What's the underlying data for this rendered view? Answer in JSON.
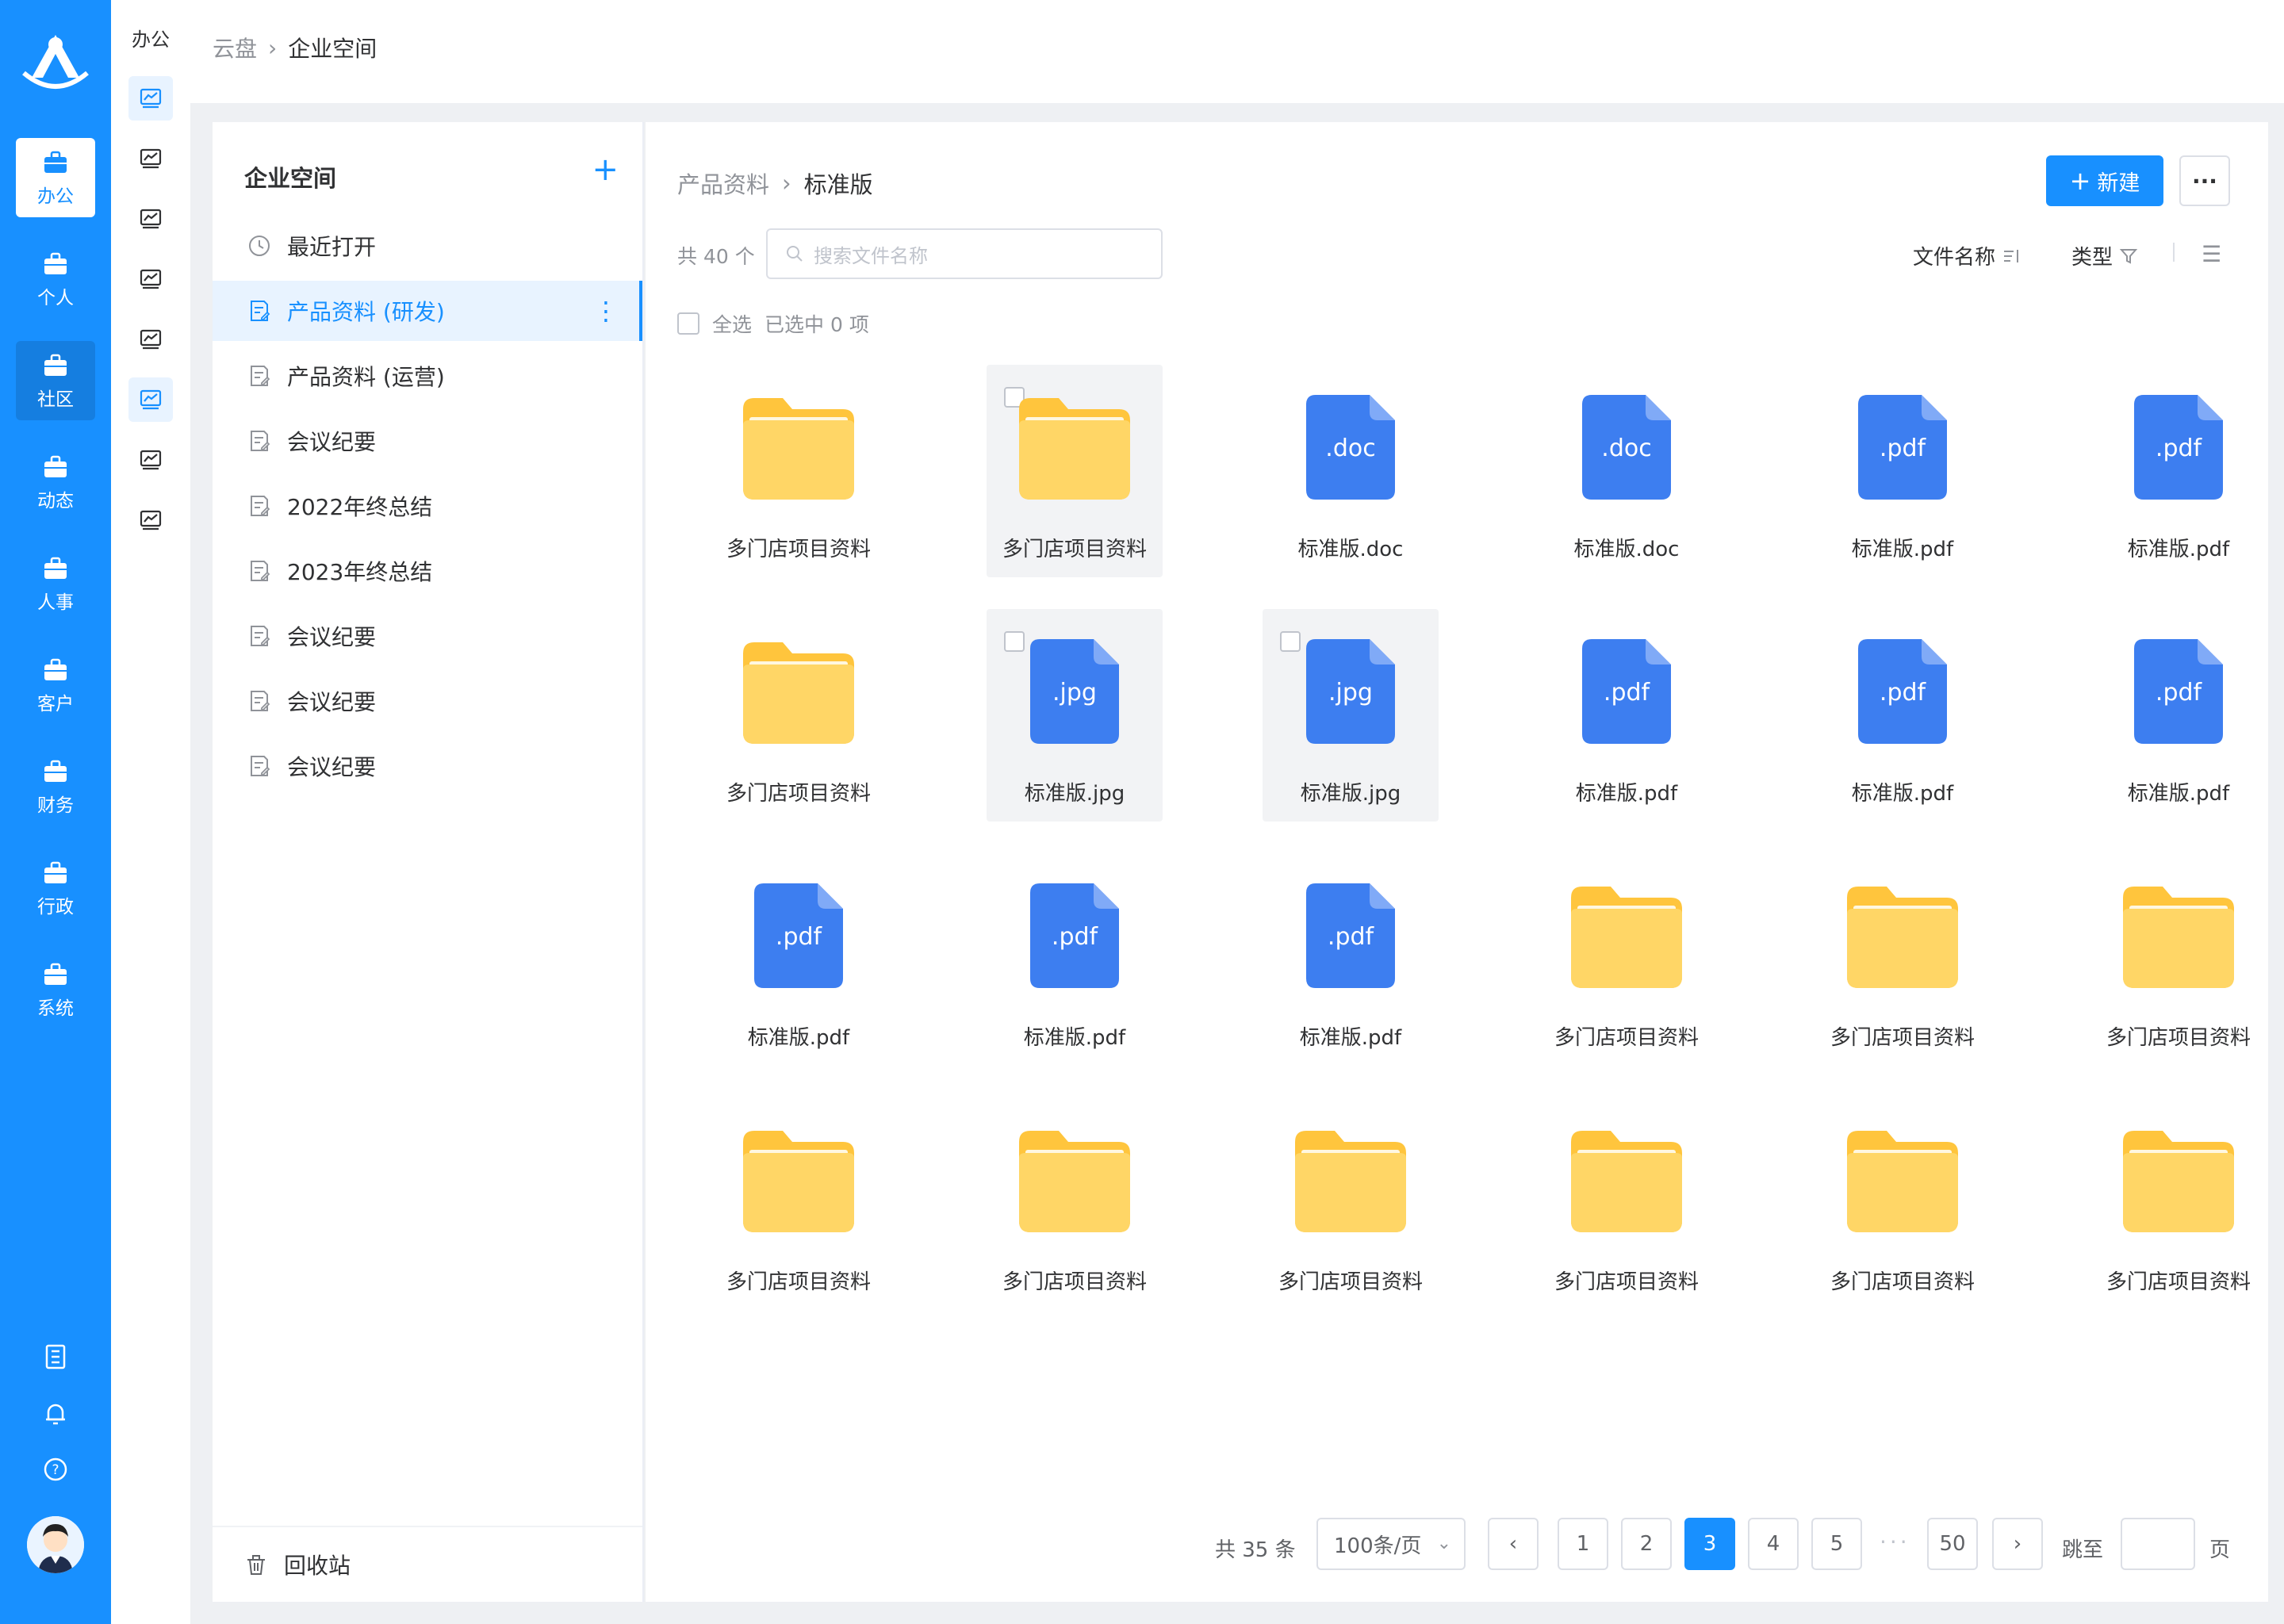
{
  "rail": {
    "items": [
      {
        "label": "办公",
        "active": true
      },
      {
        "label": "个人"
      },
      {
        "label": "社区",
        "hover": true
      },
      {
        "label": "动态"
      },
      {
        "label": "人事"
      },
      {
        "label": "客户"
      },
      {
        "label": "财务"
      },
      {
        "label": "行政"
      },
      {
        "label": "系统"
      }
    ],
    "bottom_icons": [
      "notebook-icon",
      "bell-icon",
      "help-icon"
    ]
  },
  "subnav": {
    "title": "办公",
    "icon_count": 8,
    "active_index": 5
  },
  "top_breadcrumb": {
    "root": "云盘",
    "current": "企业空间"
  },
  "folders": {
    "heading": "企业空间",
    "items": [
      {
        "label": "最近打开",
        "icon": "clock-icon"
      },
      {
        "label": "产品资料 (研发)",
        "icon": "doc-edit-icon",
        "active": true
      },
      {
        "label": "产品资料 (运营)",
        "icon": "doc-edit-icon"
      },
      {
        "label": "会议纪要",
        "icon": "doc-edit-icon"
      },
      {
        "label": "2022年终总结",
        "icon": "doc-edit-icon"
      },
      {
        "label": "2023年终总结",
        "icon": "doc-edit-icon"
      },
      {
        "label": "会议纪要",
        "icon": "doc-edit-icon"
      },
      {
        "label": "会议纪要",
        "icon": "doc-edit-icon"
      },
      {
        "label": "会议纪要",
        "icon": "doc-edit-icon"
      }
    ],
    "recycle_label": "回收站"
  },
  "main": {
    "breadcrumb": {
      "parent": "产品资料",
      "current": "标准版"
    },
    "new_button": "新建",
    "count_label": "共 40 个",
    "search_placeholder": "搜索文件名称",
    "sort_label": "文件名称",
    "type_label": "类型",
    "select_all_label": "全选",
    "selected_label": "已选中 0 项",
    "files": [
      {
        "name": "多门店项目资料",
        "type": "folder"
      },
      {
        "name": "多门店项目资料",
        "type": "folder",
        "selected": true
      },
      {
        "name": "标准版.doc",
        "type": "doc",
        "ext": ".doc"
      },
      {
        "name": "标准版.doc",
        "type": "doc",
        "ext": ".doc"
      },
      {
        "name": "标准版.pdf",
        "type": "doc",
        "ext": ".pdf"
      },
      {
        "name": "标准版.pdf",
        "type": "doc",
        "ext": ".pdf"
      },
      {
        "name": "多门店项目资料",
        "type": "folder"
      },
      {
        "name": "标准版.jpg",
        "type": "doc",
        "ext": ".jpg",
        "selected": true
      },
      {
        "name": "标准版.jpg",
        "type": "doc",
        "ext": ".jpg",
        "selected": true
      },
      {
        "name": "标准版.pdf",
        "type": "doc",
        "ext": ".pdf"
      },
      {
        "name": "标准版.pdf",
        "type": "doc",
        "ext": ".pdf"
      },
      {
        "name": "标准版.pdf",
        "type": "doc",
        "ext": ".pdf"
      },
      {
        "name": "标准版.pdf",
        "type": "doc",
        "ext": ".pdf"
      },
      {
        "name": "标准版.pdf",
        "type": "doc",
        "ext": ".pdf"
      },
      {
        "name": "标准版.pdf",
        "type": "doc",
        "ext": ".pdf"
      },
      {
        "name": "多门店项目资料",
        "type": "folder"
      },
      {
        "name": "多门店项目资料",
        "type": "folder"
      },
      {
        "name": "多门店项目资料",
        "type": "folder"
      },
      {
        "name": "多门店项目资料",
        "type": "folder"
      },
      {
        "name": "多门店项目资料",
        "type": "folder"
      },
      {
        "name": "多门店项目资料",
        "type": "folder"
      },
      {
        "name": "多门店项目资料",
        "type": "folder"
      },
      {
        "name": "多门店项目资料",
        "type": "folder"
      },
      {
        "name": "多门店项目资料",
        "type": "folder"
      }
    ]
  },
  "pagination": {
    "total": "共 35 条",
    "page_size": "100条/页",
    "pages": [
      "1",
      "2",
      "3",
      "4",
      "5"
    ],
    "current": "3",
    "last": "50",
    "ellipsis": "···",
    "jump_label": "跳至",
    "page_suffix": "页"
  },
  "colors": {
    "primary": "#1890ff",
    "folder": "#ffc53d",
    "file": "#3d7ef0",
    "bg": "#eef0f3"
  }
}
